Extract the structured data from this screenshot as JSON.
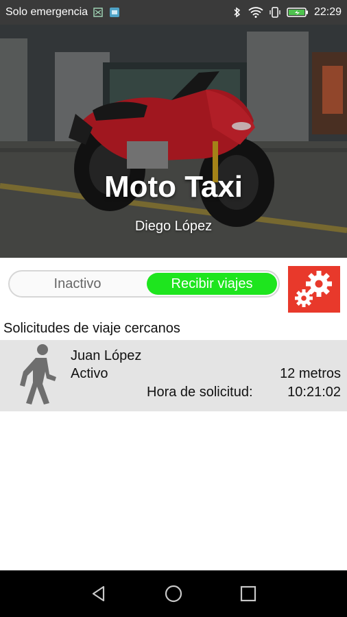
{
  "status_bar": {
    "carrier": "Solo emergencia",
    "time": "22:29",
    "icons": [
      "sim-icon",
      "screenshot-icon",
      "bluetooth-icon",
      "wifi-icon",
      "vibrate-icon",
      "battery-icon"
    ]
  },
  "header": {
    "title": "Moto Taxi",
    "driver_name": "Diego López"
  },
  "toggle": {
    "off_label": "Inactivo",
    "on_label": "Recibir viajes",
    "state": "on",
    "on_color": "#1ee51e"
  },
  "settings": {
    "icon": "gear-icon",
    "color": "#e8392b"
  },
  "requests_section": {
    "title": "Solicitudes de viaje cercanos",
    "items": [
      {
        "icon": "walking-person-icon",
        "name": "Juan López",
        "status": "Activo",
        "distance": "12 metros",
        "time_label": "Hora de solicitud:",
        "time": "10:21:02"
      }
    ]
  },
  "nav_bar": {
    "buttons": [
      "back",
      "home",
      "recents"
    ]
  }
}
